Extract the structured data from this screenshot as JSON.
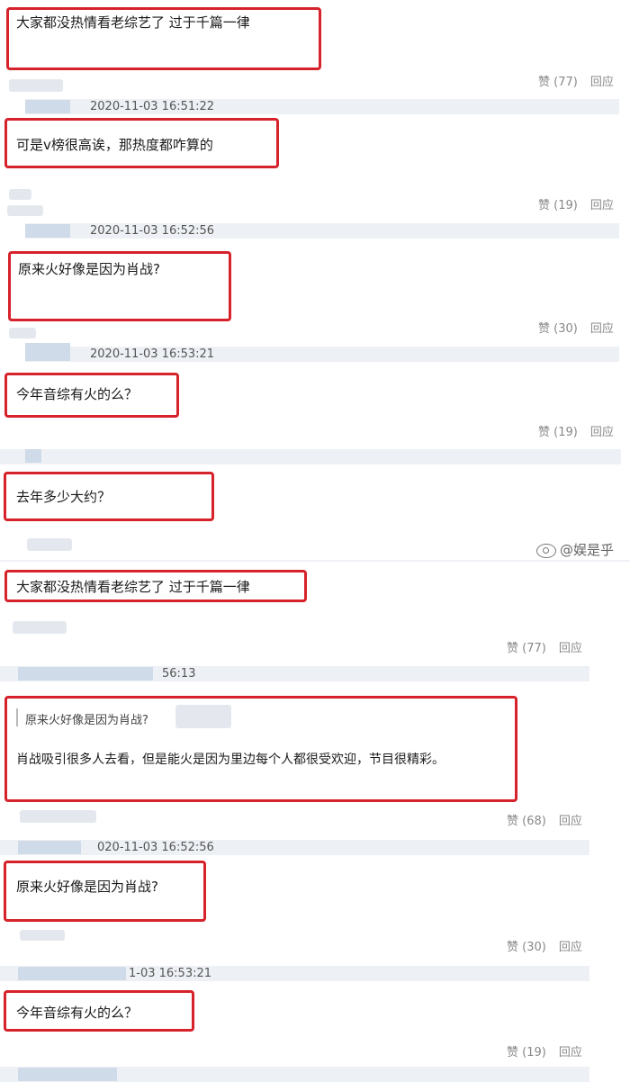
{
  "watermark": {
    "text": "@娱是乎"
  },
  "top_thread": [
    {
      "comment": "大家都没热情看老综艺了 过于千篇一律",
      "likes": "赞 (77)",
      "reply": "回应",
      "timestamp": "2020-11-03 16:51:22"
    },
    {
      "comment": "可是v榜很高诶，那热度都咋算的",
      "likes": "赞 (19)",
      "reply": "回应",
      "timestamp": "2020-11-03 16:52:56"
    },
    {
      "comment": "原来火好像是因为肖战?",
      "likes": "赞 (30)",
      "reply": "回应",
      "timestamp": "2020-11-03 16:53:21"
    },
    {
      "comment": "今年音综有火的么？",
      "likes": "赞 (19)",
      "reply": "回应"
    },
    {
      "comment": "去年多少大约？"
    }
  ],
  "bottom_thread": [
    {
      "comment": "大家都没热情看老综艺了 过于千篇一律",
      "likes": "赞 (77)",
      "reply": "回应",
      "timestamp_partial": "56:13"
    },
    {
      "quote": "原来火好像是因为肖战?",
      "comment": "肖战吸引很多人去看，但是能火是因为里边每个人都很受欢迎，节目很精彩。",
      "likes": "赞 (68)",
      "reply": "回应",
      "timestamp_partial": "020-11-03 16:52:56"
    },
    {
      "comment": "原来火好像是因为肖战?",
      "likes": "赞 (30)",
      "reply": "回应",
      "timestamp_partial": "1-03 16:53:21"
    },
    {
      "comment": "今年音综有火的么？",
      "likes": "赞 (19)",
      "reply": "回应"
    }
  ]
}
